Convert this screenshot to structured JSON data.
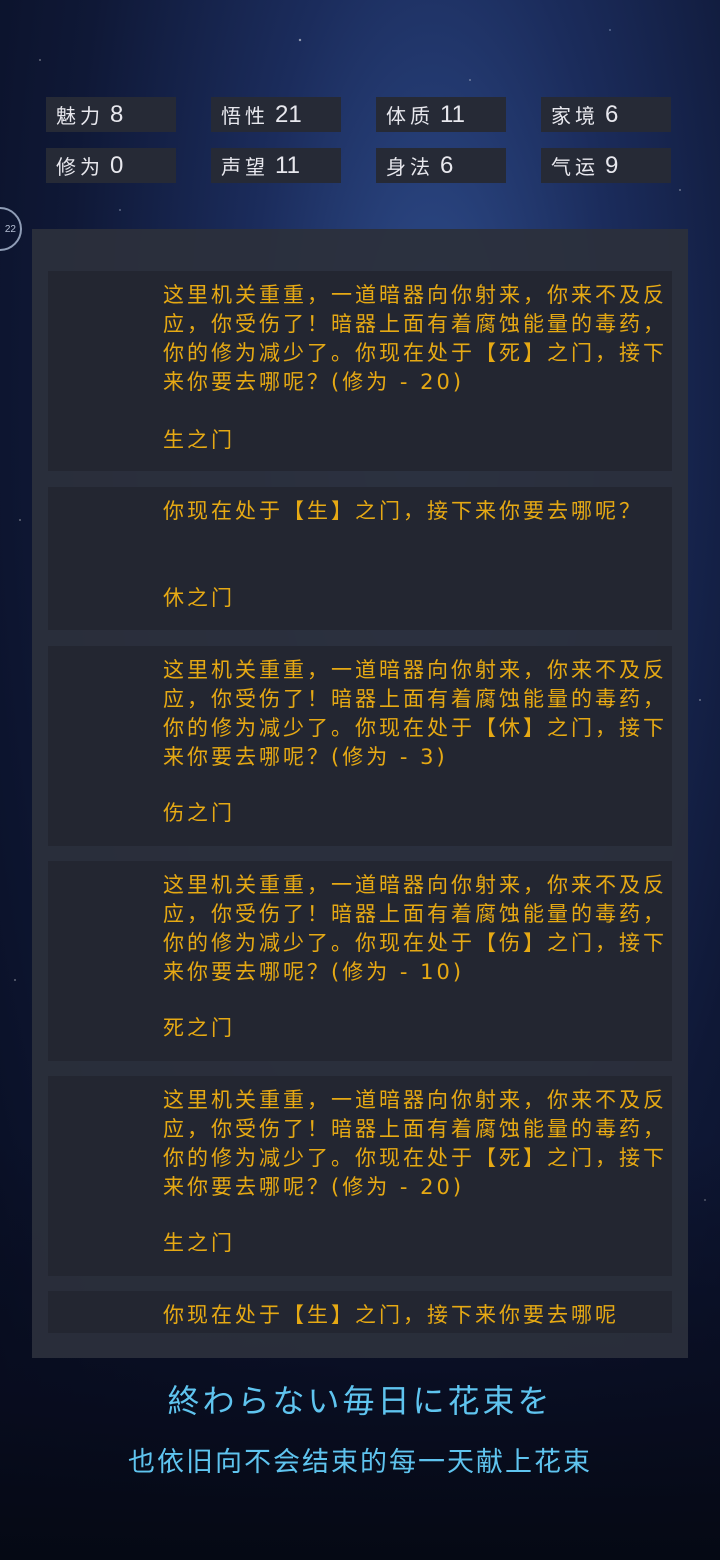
{
  "stats": [
    {
      "label": "魅力",
      "value": "8"
    },
    {
      "label": "悟性",
      "value": "21"
    },
    {
      "label": "体质",
      "value": "11"
    },
    {
      "label": "家境",
      "value": "6"
    },
    {
      "label": "修为",
      "value": "0"
    },
    {
      "label": "声望",
      "value": "11"
    },
    {
      "label": "身法",
      "value": "6"
    },
    {
      "label": "气运",
      "value": "9"
    }
  ],
  "side_badge": "22",
  "events": [
    {
      "text": "这里机关重重，一道暗器向你射来，你来不及反应，你受伤了！暗器上面有着腐蚀能量的毒药，你的修为减少了。你现在处于【死】之门，接下来你要去哪呢？(修为 - 20)",
      "choice": "生之门"
    },
    {
      "text": "你现在处于【生】之门，接下来你要去哪呢？",
      "choice": "休之门"
    },
    {
      "text": "这里机关重重，一道暗器向你射来，你来不及反应，你受伤了！暗器上面有着腐蚀能量的毒药，你的修为减少了。你现在处于【休】之门，接下来你要去哪呢？(修为 - 3)",
      "choice": "伤之门"
    },
    {
      "text": "这里机关重重，一道暗器向你射来，你来不及反应，你受伤了！暗器上面有着腐蚀能量的毒药，你的修为减少了。你现在处于【伤】之门，接下来你要去哪呢？(修为 - 10)",
      "choice": "死之门"
    },
    {
      "text": "这里机关重重，一道暗器向你射来，你来不及反应，你受伤了！暗器上面有着腐蚀能量的毒药，你的修为减少了。你现在处于【死】之门，接下来你要去哪呢？(修为 - 20)",
      "choice": "生之门"
    },
    {
      "text": "你现在处于【生】之门，接下来你要去哪呢"
    }
  ],
  "caption": {
    "line1": "終わらない毎日に花束を",
    "line2": "也依旧向不会结束的每一天献上花束"
  }
}
